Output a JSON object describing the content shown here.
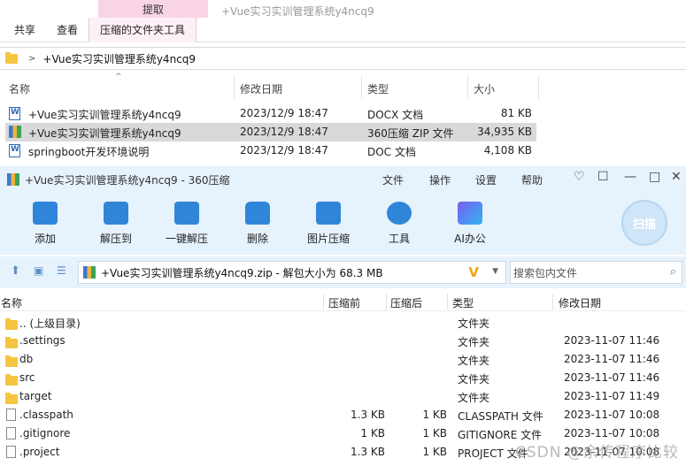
{
  "explorer": {
    "context_tab": "提取",
    "window_title": "+Vue实习实训管理系统y4ncq9",
    "ribbon_tabs": [
      "共享",
      "查看",
      "压缩的文件夹工具"
    ],
    "address": {
      "sep": ">",
      "path": "+Vue实习实训管理系统y4ncq9"
    },
    "columns": {
      "name": "名称",
      "date": "修改日期",
      "type": "类型",
      "size": "大小"
    },
    "sort_caret": "^",
    "files": [
      {
        "name": "+Vue实习实训管理系统y4ncq9",
        "date": "2023/12/9 18:47",
        "type": "DOCX 文档",
        "size": "81 KB"
      },
      {
        "name": "+Vue实习实训管理系统y4ncq9",
        "date": "2023/12/9 18:47",
        "type": "360压缩 ZIP 文件",
        "size": "34,935 KB"
      },
      {
        "name": "springboot开发环境说明",
        "date": "2023/12/9 18:47",
        "type": "DOC 文档",
        "size": "4,108 KB"
      }
    ]
  },
  "zip": {
    "title": "+Vue实习实训管理系统y4ncq9 - 360压缩",
    "menus": [
      "文件",
      "操作",
      "设置",
      "帮助"
    ],
    "window_controls": [
      "♡",
      "☐",
      "—",
      "□",
      "✕"
    ],
    "toolbar": [
      {
        "label": "添加",
        "icon": "add-icon",
        "color": "#2f86d9"
      },
      {
        "label": "解压到",
        "icon": "extract-to-icon",
        "color": "#2f86d9"
      },
      {
        "label": "一键解压",
        "icon": "one-click-extract-icon",
        "color": "#2f86d9"
      },
      {
        "label": "删除",
        "icon": "delete-icon",
        "color": "#2f86d9"
      },
      {
        "label": "图片压缩",
        "icon": "image-compress-icon",
        "color": "#2f86d9"
      },
      {
        "label": "工具",
        "icon": "tools-icon",
        "color": "#2f86d9"
      },
      {
        "label": "AI办公",
        "icon": "ai-office-icon",
        "color": "#3a6ff0"
      }
    ],
    "scan_label": "扫描",
    "archive_path": "+Vue实习实训管理系统y4ncq9.zip - 解包大小为 68.3 MB",
    "search_placeholder": "搜索包内文件",
    "columns": {
      "name": "名称",
      "compressed_before": "压缩前",
      "compressed_after": "压缩后",
      "type": "类型",
      "date": "修改日期"
    },
    "entries": [
      {
        "name": ".. (上级目录)",
        "before": "",
        "after": "",
        "type": "文件夹",
        "date": "",
        "kind": "folder"
      },
      {
        "name": ".settings",
        "before": "",
        "after": "",
        "type": "文件夹",
        "date": "2023-11-07 11:46",
        "kind": "folder"
      },
      {
        "name": "db",
        "before": "",
        "after": "",
        "type": "文件夹",
        "date": "2023-11-07 11:46",
        "kind": "folder"
      },
      {
        "name": "src",
        "before": "",
        "after": "",
        "type": "文件夹",
        "date": "2023-11-07 11:46",
        "kind": "folder"
      },
      {
        "name": "target",
        "before": "",
        "after": "",
        "type": "文件夹",
        "date": "2023-11-07 11:49",
        "kind": "folder"
      },
      {
        "name": ".classpath",
        "before": "1.3 KB",
        "after": "1 KB",
        "type": "CLASSPATH 文件",
        "date": "2023-11-07 10:08",
        "kind": "file"
      },
      {
        "name": ".gitignore",
        "before": "1 KB",
        "after": "1 KB",
        "type": "GITIGNORE 文件",
        "date": "2023-11-07 10:08",
        "kind": "file"
      },
      {
        "name": ".project",
        "before": "1.3 KB",
        "after": "1 KB",
        "type": "PROJECT 文件",
        "date": "2023-11-07 10:08",
        "kind": "file"
      }
    ]
  },
  "watermark": "CSDN @余传程序比较"
}
